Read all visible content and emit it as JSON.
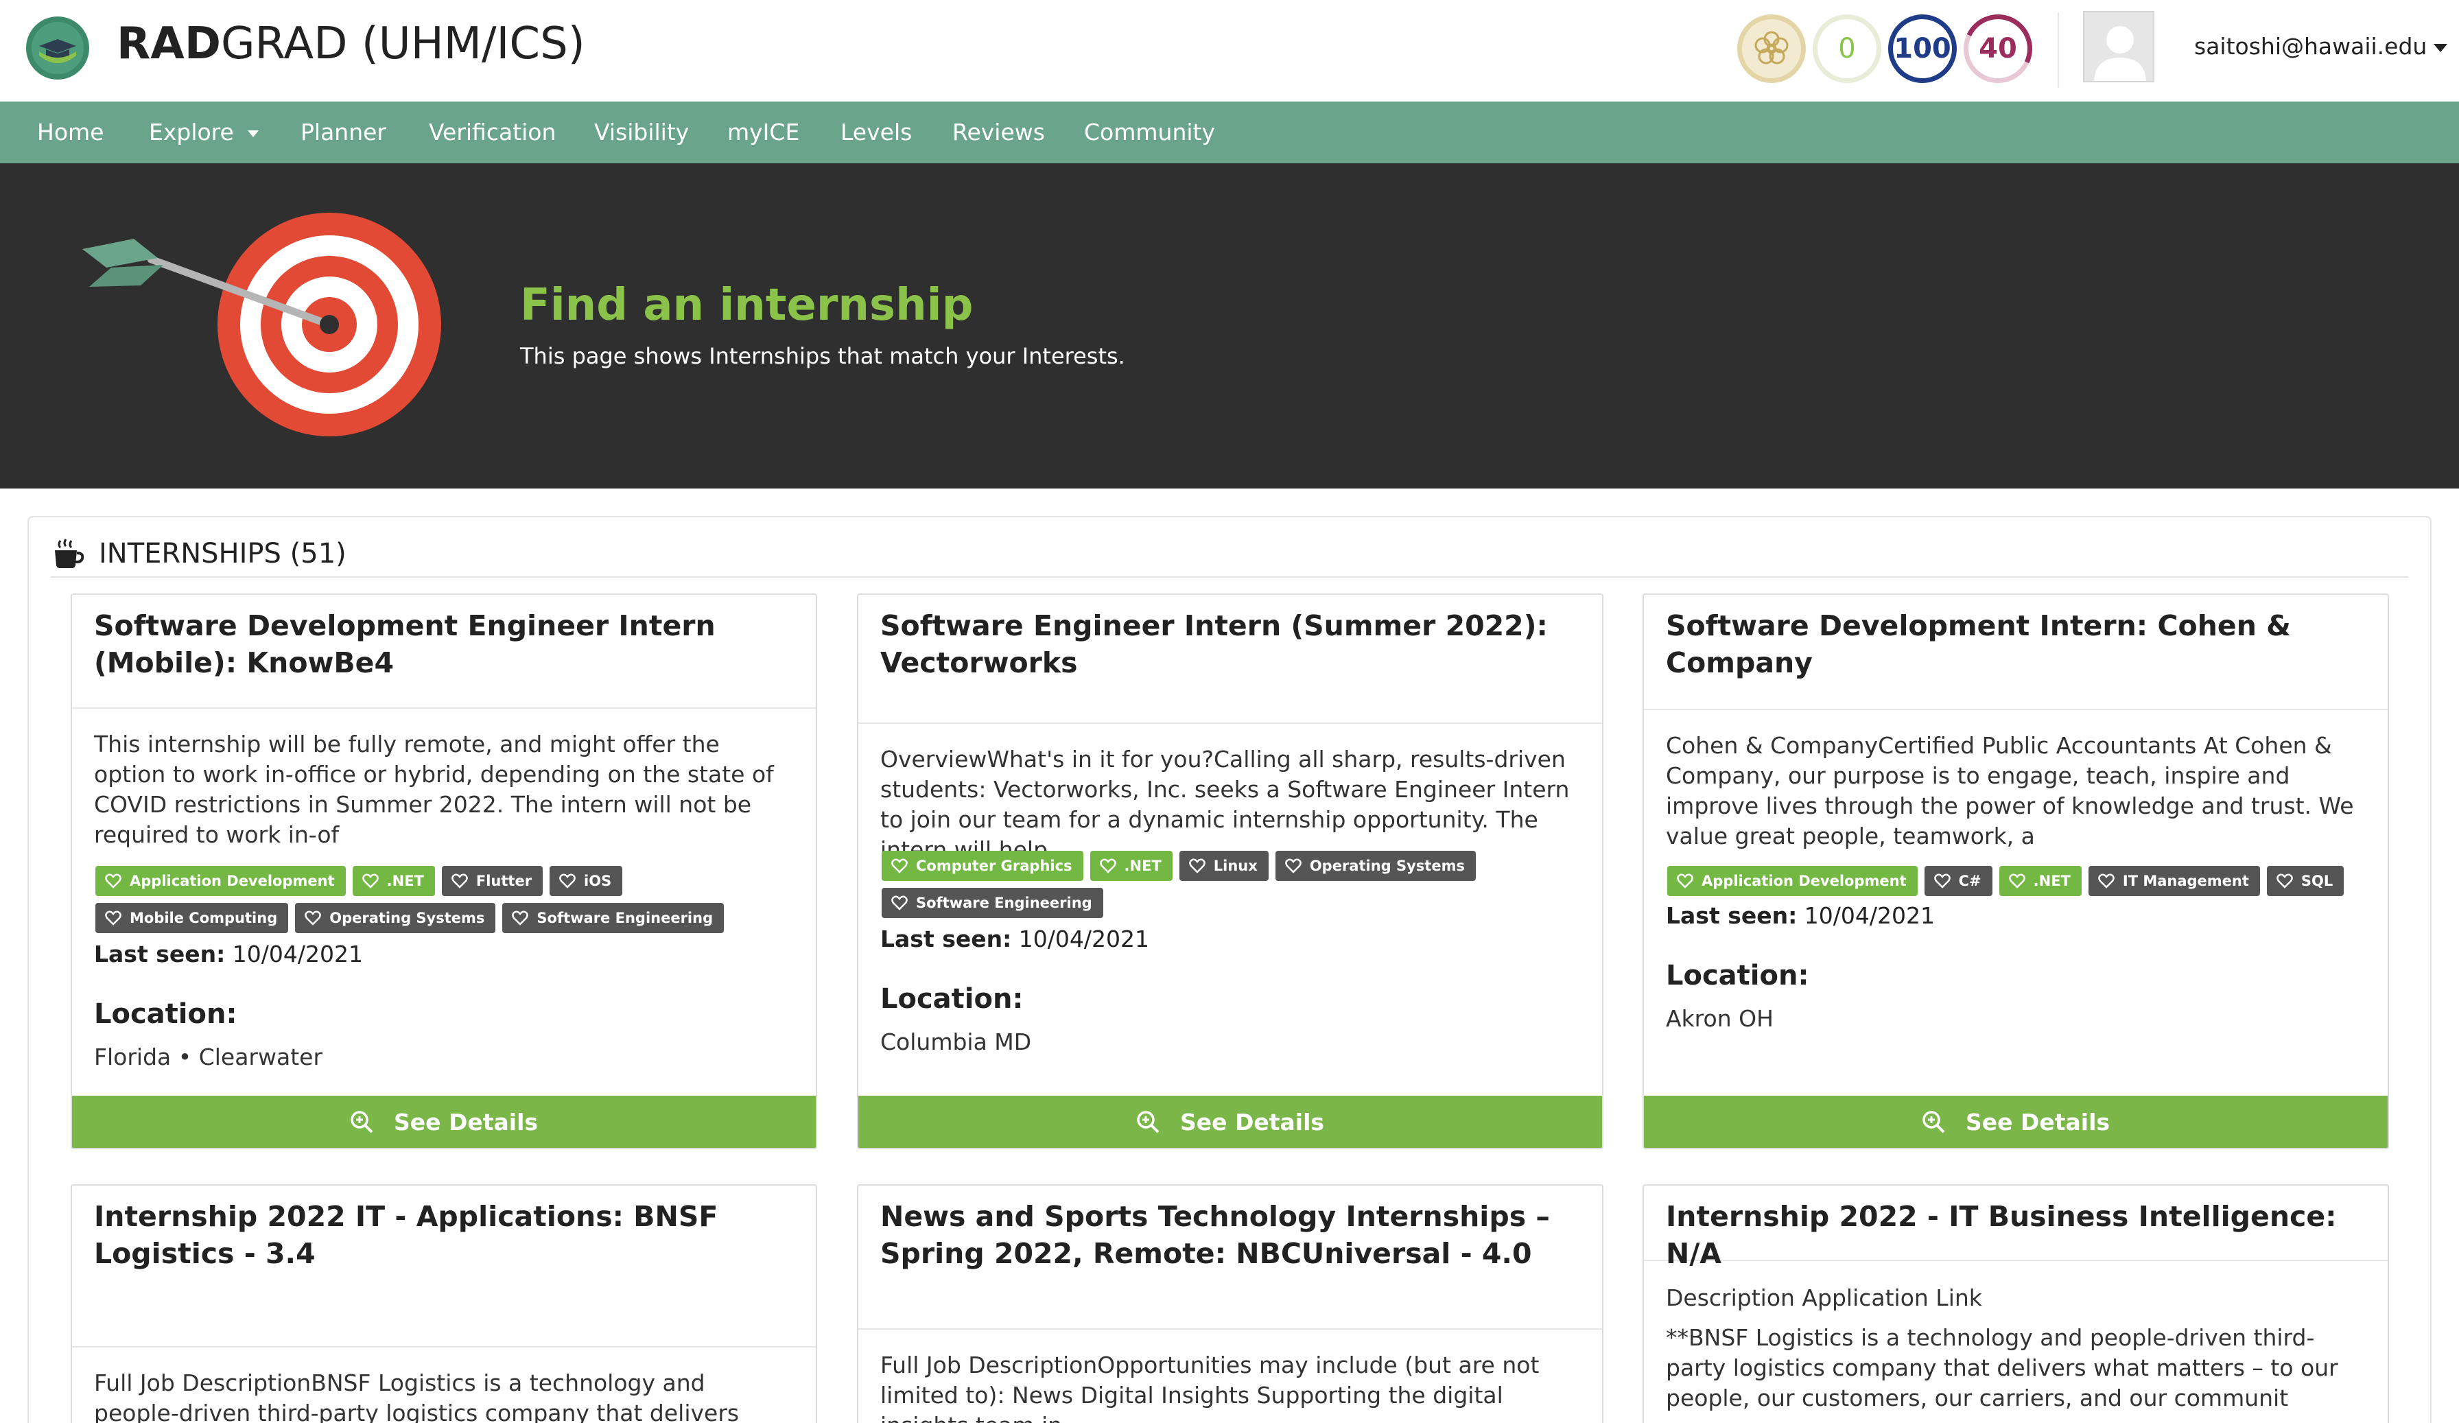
{
  "header": {
    "brand_bold": "RAD",
    "brand_rest": "GRAD (UHM/ICS)",
    "scores": {
      "innovation": "0",
      "competency": "100",
      "experience": "40"
    },
    "user_email": "saitoshi@hawaii.edu"
  },
  "nav": {
    "items": [
      {
        "label": "Home"
      },
      {
        "label": "Explore"
      },
      {
        "label": "Planner"
      },
      {
        "label": "Verification"
      },
      {
        "label": "Visibility"
      },
      {
        "label": "myICE"
      },
      {
        "label": "Levels"
      },
      {
        "label": "Reviews"
      },
      {
        "label": "Community"
      }
    ]
  },
  "banner": {
    "title": "Find an internship",
    "subtitle": "This page shows Internships that match your Interests."
  },
  "section": {
    "title": "INTERNSHIPS (51)"
  },
  "colors": {
    "nav": "#6aa58b",
    "banner": "#2f2f2f",
    "accent_green": "#8bc34a",
    "tag_green": "#74b844",
    "tag_grey": "#555555",
    "button_green": "#7ab648"
  },
  "cards": [
    {
      "title": "Software Development Engineer Intern (Mobile): KnowBe4",
      "description": "This internship will be fully remote, and might offer the option to work in-office or hybrid, depending on the state of COVID restrictions in Summer 2022. The intern will not be required to work in-of",
      "tags": [
        {
          "label": "Application Development",
          "style": "green"
        },
        {
          "label": ".NET",
          "style": "green"
        },
        {
          "label": "Flutter",
          "style": "grey"
        },
        {
          "label": "iOS",
          "style": "grey"
        },
        {
          "label": "Mobile Computing",
          "style": "grey"
        },
        {
          "label": "Operating Systems",
          "style": "grey"
        },
        {
          "label": "Software Engineering",
          "style": "grey"
        }
      ],
      "last_seen_label": "Last seen:",
      "last_seen": "10/04/2021",
      "location_label": "Location:",
      "location": "Florida • Clearwater",
      "button": "See Details"
    },
    {
      "title": "Software Engineer Intern (Summer 2022): Vectorworks",
      "description": "OverviewWhat's in it for you?Calling all sharp, results-driven students: Vectorworks, Inc. seeks a Software Engineer Intern to join our team for a dynamic internship opportunity. The intern will help",
      "tags": [
        {
          "label": "Computer Graphics",
          "style": "green"
        },
        {
          "label": ".NET",
          "style": "green"
        },
        {
          "label": "Linux",
          "style": "grey"
        },
        {
          "label": "Operating Systems",
          "style": "grey"
        },
        {
          "label": "Software Engineering",
          "style": "grey"
        }
      ],
      "last_seen_label": "Last seen:",
      "last_seen": "10/04/2021",
      "location_label": "Location:",
      "location": "Columbia MD",
      "button": "See Details"
    },
    {
      "title": "Software Development Intern: Cohen & Company",
      "description": "Cohen & CompanyCertified Public Accountants At Cohen & Company, our purpose is to engage, teach, inspire and improve lives through the power of knowledge and trust. We value great people, teamwork, a",
      "tags": [
        {
          "label": "Application Development",
          "style": "green"
        },
        {
          "label": "C#",
          "style": "grey"
        },
        {
          "label": ".NET",
          "style": "green"
        },
        {
          "label": "IT Management",
          "style": "grey"
        },
        {
          "label": "SQL",
          "style": "grey"
        }
      ],
      "last_seen_label": "Last seen:",
      "last_seen": "10/04/2021",
      "location_label": "Location:",
      "location": "Akron OH",
      "button": "See Details"
    },
    {
      "title": "Internship 2022 IT - Applications: BNSF Logistics - 3.4",
      "description": "Full Job DescriptionBNSF Logistics is a technology and people-driven third-party logistics company that delivers what matters – to our"
    },
    {
      "title": "News and Sports Technology Internships – Spring 2022, Remote: NBCUniversal - 4.0",
      "description": "Full Job DescriptionOpportunities may include (but are not limited to): News Digital Insights Supporting the digital insights team in"
    },
    {
      "title": "Internship 2022 - IT Business Intelligence: N/A",
      "description_line1": "Description Application Link",
      "description": "**BNSF Logistics is a technology and people-driven third-party logistics company that delivers what matters – to our people, our customers, our carriers, and our communit"
    }
  ]
}
